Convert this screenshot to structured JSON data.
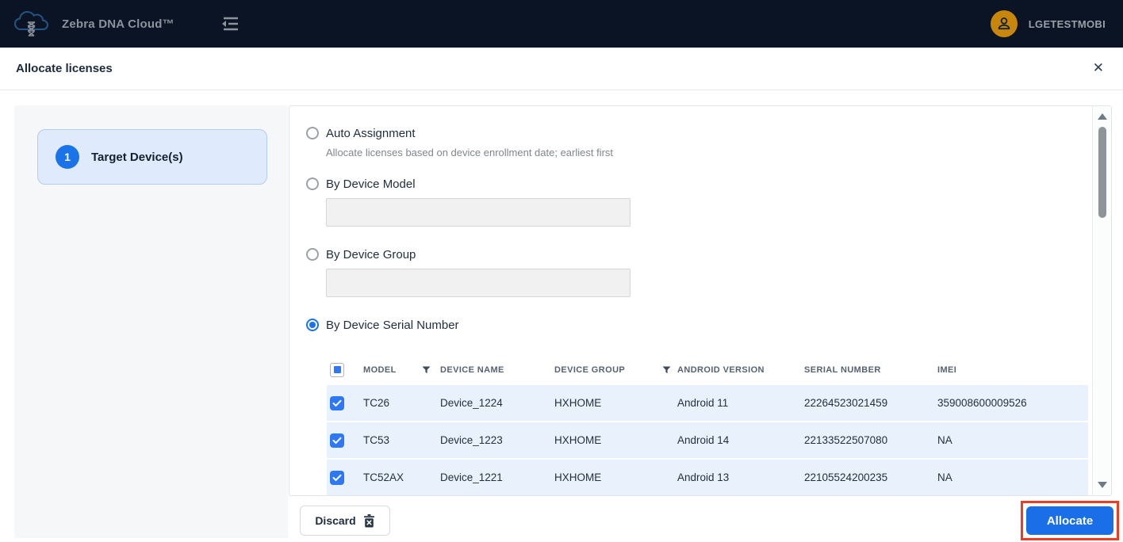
{
  "header": {
    "app_title": "Zebra DNA Cloud™",
    "username": "LGETESTMOBI"
  },
  "dialog": {
    "title": "Allocate licenses",
    "close_glyph": "✕"
  },
  "steps": [
    {
      "number": "1",
      "label": "Target Device(s)"
    }
  ],
  "options": [
    {
      "label": "Auto Assignment",
      "description": "Allocate licenses based on device enrollment date; earliest first",
      "selected": false
    },
    {
      "label": "By Device Model",
      "input_value": "",
      "selected": false
    },
    {
      "label": "By Device Group",
      "input_value": "",
      "selected": false
    },
    {
      "label": "By Device Serial Number",
      "selected": true
    }
  ],
  "table": {
    "select_all_state": "indeterminate",
    "columns": [
      "MODEL",
      "DEVICE NAME",
      "DEVICE GROUP",
      "ANDROID VERSION",
      "SERIAL NUMBER",
      "IMEI"
    ],
    "filter_columns": [
      "MODEL",
      "DEVICE GROUP"
    ],
    "rows": [
      {
        "checked": true,
        "model": "TC26",
        "name": "Device_1224",
        "group": "HXHOME",
        "android": "Android 11",
        "serial": "22264523021459",
        "imei": "359008600009526"
      },
      {
        "checked": true,
        "model": "TC53",
        "name": "Device_1223",
        "group": "HXHOME",
        "android": "Android 14",
        "serial": "22133522507080",
        "imei": "NA"
      },
      {
        "checked": true,
        "model": "TC52AX",
        "name": "Device_1221",
        "group": "HXHOME",
        "android": "Android 13",
        "serial": "22105524200235",
        "imei": "NA"
      }
    ]
  },
  "footer": {
    "discard_label": "Discard",
    "allocate_label": "Allocate"
  },
  "colors": {
    "topbar_bg": "#0a1424",
    "accent_blue": "#1a73e8",
    "row_selected_bg": "#e9f1fc",
    "step_card_bg": "#dfeafc",
    "avatar_bg": "#c8860b",
    "annotation_red": "#ee3b24"
  }
}
